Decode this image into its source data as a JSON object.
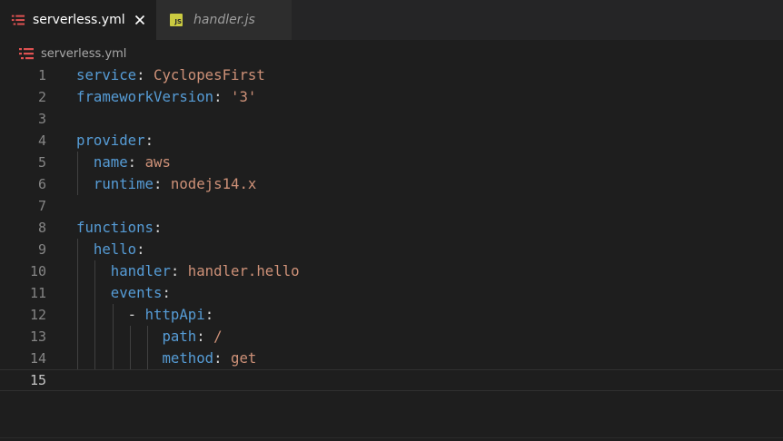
{
  "tabs": [
    {
      "label": "serverless.yml",
      "active": true,
      "icon": "yaml-file-icon",
      "close": "×"
    },
    {
      "label": "handler.js",
      "active": false,
      "icon": "js-file-icon",
      "icon_text": "JS"
    }
  ],
  "breadcrumb": {
    "file": "serverless.yml",
    "icon": "yaml-file-icon"
  },
  "colors": {
    "key": "#569cd6",
    "value": "#ce9178",
    "punct": "#d4d4d4",
    "yaml_icon": "#e05252",
    "js_icon_bg": "#cbcb41"
  },
  "editor": {
    "current_line": 15,
    "lines": [
      {
        "n": "1",
        "indent": "",
        "key": "service",
        "sep": ": ",
        "value": "CyclopesFirst"
      },
      {
        "n": "2",
        "indent": "",
        "key": "frameworkVersion",
        "sep": ": ",
        "value": "'3'"
      },
      {
        "n": "3",
        "indent": "",
        "key": "",
        "sep": "",
        "value": ""
      },
      {
        "n": "4",
        "indent": "",
        "key": "provider",
        "sep": ":",
        "value": ""
      },
      {
        "n": "5",
        "indent": "  ",
        "key": "name",
        "sep": ": ",
        "value": "aws"
      },
      {
        "n": "6",
        "indent": "  ",
        "key": "runtime",
        "sep": ": ",
        "value": "nodejs14.x"
      },
      {
        "n": "7",
        "indent": "",
        "key": "",
        "sep": "",
        "value": ""
      },
      {
        "n": "8",
        "indent": "",
        "key": "functions",
        "sep": ":",
        "value": ""
      },
      {
        "n": "9",
        "indent": "  ",
        "key": "hello",
        "sep": ":",
        "value": ""
      },
      {
        "n": "10",
        "indent": "    ",
        "key": "handler",
        "sep": ": ",
        "value": "handler.hello"
      },
      {
        "n": "11",
        "indent": "    ",
        "key": "events",
        "sep": ":",
        "value": ""
      },
      {
        "n": "12",
        "indent": "      - ",
        "key": "httpApi",
        "sep": ":",
        "value": ""
      },
      {
        "n": "13",
        "indent": "          ",
        "key": "path",
        "sep": ": ",
        "value": "/"
      },
      {
        "n": "14",
        "indent": "          ",
        "key": "method",
        "sep": ": ",
        "value": "get"
      },
      {
        "n": "15",
        "indent": "",
        "key": "",
        "sep": "",
        "value": ""
      }
    ]
  }
}
